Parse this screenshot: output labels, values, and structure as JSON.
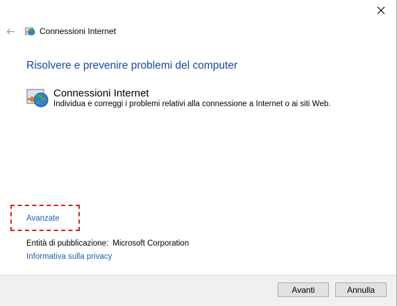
{
  "window": {
    "nav_title": "Connessioni Internet",
    "close_icon": "close-icon",
    "back_icon": "back-arrow-icon"
  },
  "main": {
    "heading": "Risolvere e prevenire problemi del computer",
    "item": {
      "icon": "internet-connections-icon",
      "title": "Connessioni Internet",
      "description": "Individua e correggi i problemi relativi alla connessione a Internet o ai siti Web."
    },
    "advanced_link": "Avanzate",
    "publisher_label": "Entità di pubblicazione:",
    "publisher_value": "Microsoft Corporation",
    "privacy_link": "Informativa sulla privacy"
  },
  "footer": {
    "next_label": "Avanti",
    "cancel_label": "Annulla"
  },
  "colors": {
    "heading": "#17479e",
    "link": "#1a5fb4",
    "highlight_border": "#e01818",
    "footer_bg": "#f0f0f0"
  }
}
